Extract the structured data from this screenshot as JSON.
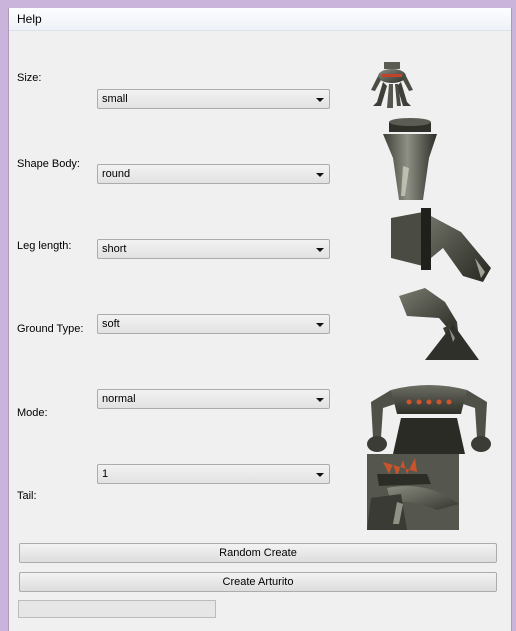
{
  "menu": {
    "help": "Help"
  },
  "fields": [
    {
      "label": "Size:",
      "value": "small"
    },
    {
      "label": "Shape Body:",
      "value": "round"
    },
    {
      "label": "Leg length:",
      "value": "short"
    },
    {
      "label": "Ground Type:",
      "value": "soft"
    },
    {
      "label": "Mode:",
      "value": "normal"
    },
    {
      "label": "Tail:",
      "value": "1"
    }
  ],
  "buttons": {
    "random_create": "Random Create",
    "create_arturito": "Create Arturito"
  },
  "progress": {
    "value": 0
  },
  "previews": [
    "robot-preview-image",
    "body-preview-image",
    "leg-upper-preview-image",
    "leg-lower-preview-image",
    "mode-preview-image",
    "tail-preview-image"
  ]
}
